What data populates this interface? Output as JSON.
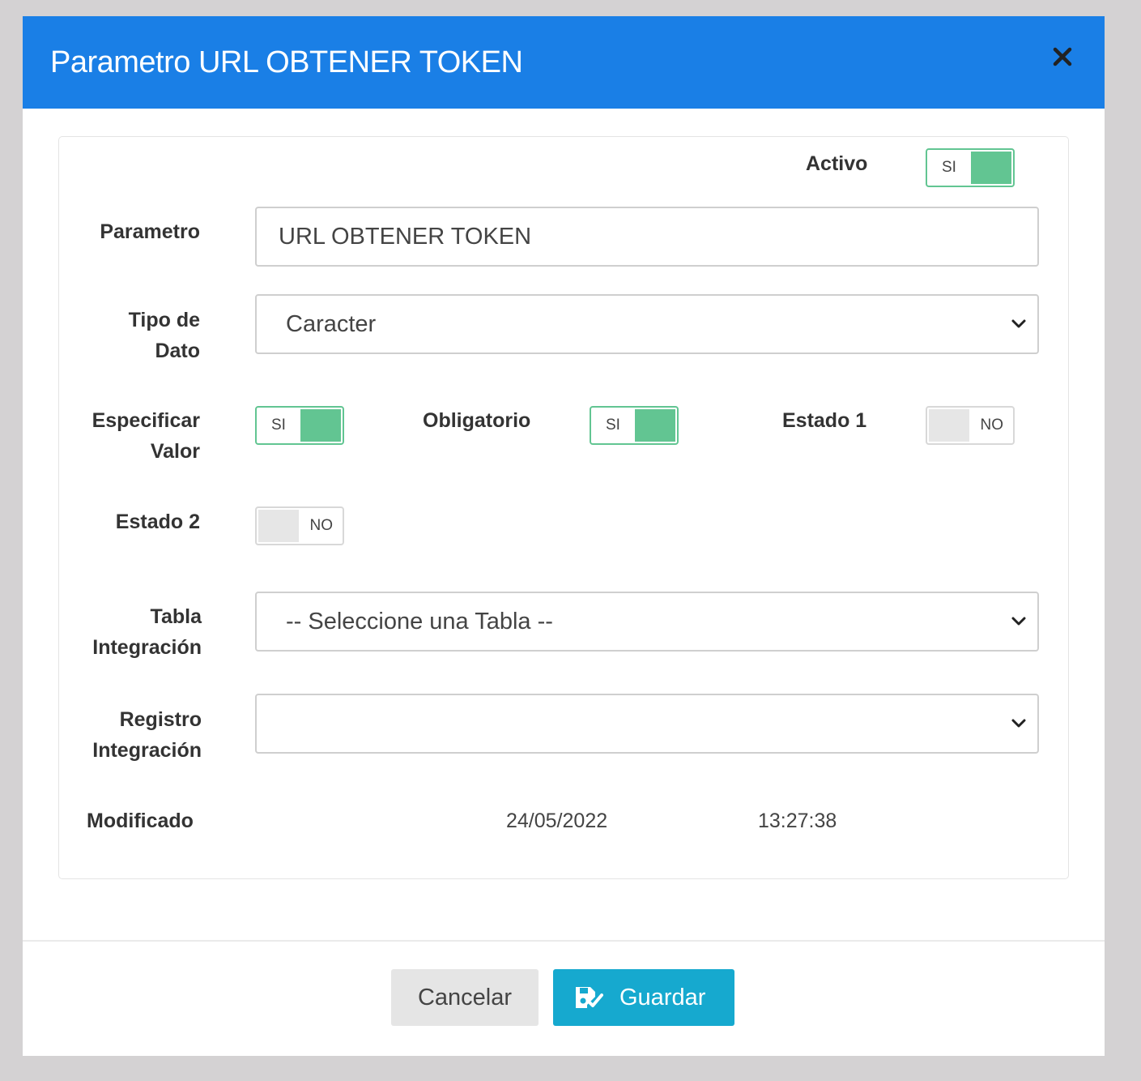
{
  "header": {
    "title": "Parametro URL OBTENER TOKEN"
  },
  "form": {
    "activo": {
      "label": "Activo",
      "toggle_text": "SI",
      "on": true
    },
    "parametro": {
      "label": "Parametro",
      "value": "URL OBTENER TOKEN"
    },
    "tipo_dato": {
      "label_line1": "Tipo de",
      "label_line2": "Dato",
      "value": "Caracter"
    },
    "especificar_valor": {
      "label_line1": "Especificar",
      "label_line2": "Valor",
      "toggle_text": "SI",
      "on": true
    },
    "obligatorio": {
      "label": "Obligatorio",
      "toggle_text": "SI",
      "on": true
    },
    "estado1": {
      "label": "Estado 1",
      "toggle_text": "NO",
      "on": false
    },
    "estado2": {
      "label": "Estado 2",
      "toggle_text": "NO",
      "on": false
    },
    "tabla_integracion": {
      "label_line1": "Tabla",
      "label_line2": "Integración",
      "value": "-- Seleccione una Tabla --"
    },
    "registro_integracion": {
      "label_line1": "Registro",
      "label_line2": "Integración",
      "value": ""
    },
    "modificado": {
      "label": "Modificado",
      "date": "24/05/2022",
      "time": "13:27:38"
    }
  },
  "footer": {
    "cancel_label": "Cancelar",
    "save_label": "Guardar"
  },
  "colors": {
    "header": "#1a7fe6",
    "toggle_on": "#62c592",
    "save_button": "#16a9cf"
  },
  "icons": {
    "close": "close-icon",
    "save": "save-icon",
    "dropdown": "chevron-down-icon"
  }
}
